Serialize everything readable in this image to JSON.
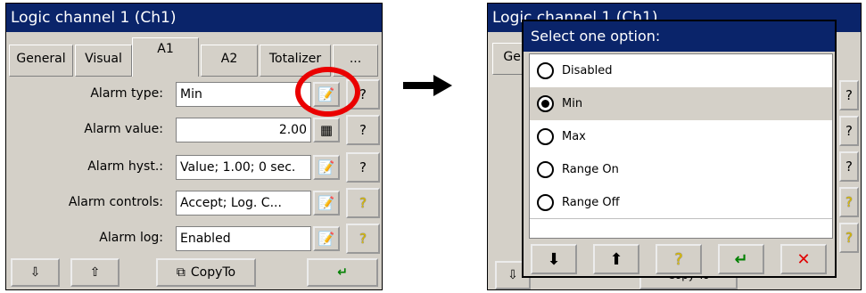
{
  "left_window": {
    "title": "Logic channel 1 (Ch1)",
    "tabs": [
      "General",
      "Visual",
      "A1",
      "A2",
      "Totalizer",
      "..."
    ],
    "rows": [
      {
        "label": "Alarm type:",
        "value": "Min"
      },
      {
        "label": "Alarm value:",
        "value": "2.00"
      },
      {
        "label": "Alarm hyst.:",
        "value": "Value; 1.00; 0 sec."
      },
      {
        "label": "Alarm controls:",
        "value": "Accept; Log. C..."
      },
      {
        "label": "Alarm log:",
        "value": "Enabled"
      }
    ],
    "copy_label": "CopyTo",
    "icons": {
      "edit": "edit-icon",
      "calc": "calculator-icon",
      "help": "help-icon",
      "enter": "enter-icon"
    }
  },
  "right_window": {
    "title_partial": "Logic channel 1 (Ch1)",
    "tab_partial": "Ger",
    "dialog": {
      "title": "Select one option:",
      "options": [
        "Disabled",
        "Min",
        "Max",
        "Range On",
        "Range Off"
      ],
      "selected": "Min"
    },
    "bottom_partial": "Copy To"
  },
  "colors": {
    "title_bg": "#0a246a",
    "highlight": "#ea0000",
    "panel": "#d4d0c8"
  }
}
